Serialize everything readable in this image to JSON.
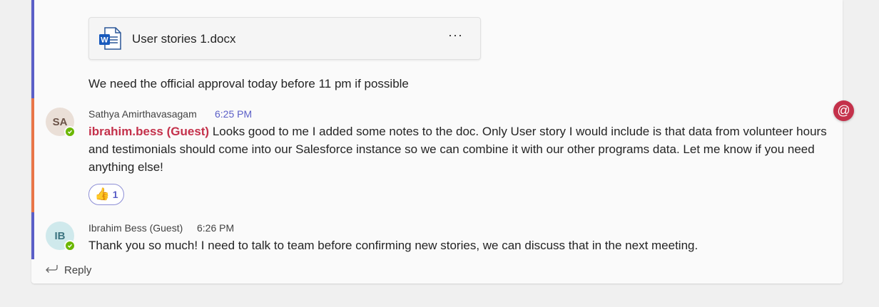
{
  "file_attachment": {
    "name": "User stories 1.docx",
    "more_label": "···",
    "icon": "word-doc-icon"
  },
  "messages": [
    {
      "text": "We need the official approval today before 11 pm if possible"
    },
    {
      "avatar_initials": "SA",
      "sender": "Sathya Amirthavasagam",
      "time": "6:25 PM",
      "mention": "ibrahim.bess (Guest)",
      "text": " Looks good to me I added some notes to the doc. Only User story I would include is that data from volunteer hours and testimonials should come into our Salesforce instance so we can combine it with our other programs data. Let me know if you need anything else!",
      "reaction": {
        "emoji": "👍",
        "count": "1"
      }
    },
    {
      "avatar_initials": "IB",
      "sender": "Ibrahim Bess (Guest)",
      "time": "6:26 PM",
      "text": "Thank you so much! I need to talk to team before confirming new stories, we can discuss that in the next meeting."
    }
  ],
  "mention_badge": "@",
  "reply_label": "Reply",
  "colors": {
    "accent": "#5b5fc7",
    "mention_bar": "#e97548",
    "mention": "#c4314b",
    "presence": "#6bb700"
  }
}
